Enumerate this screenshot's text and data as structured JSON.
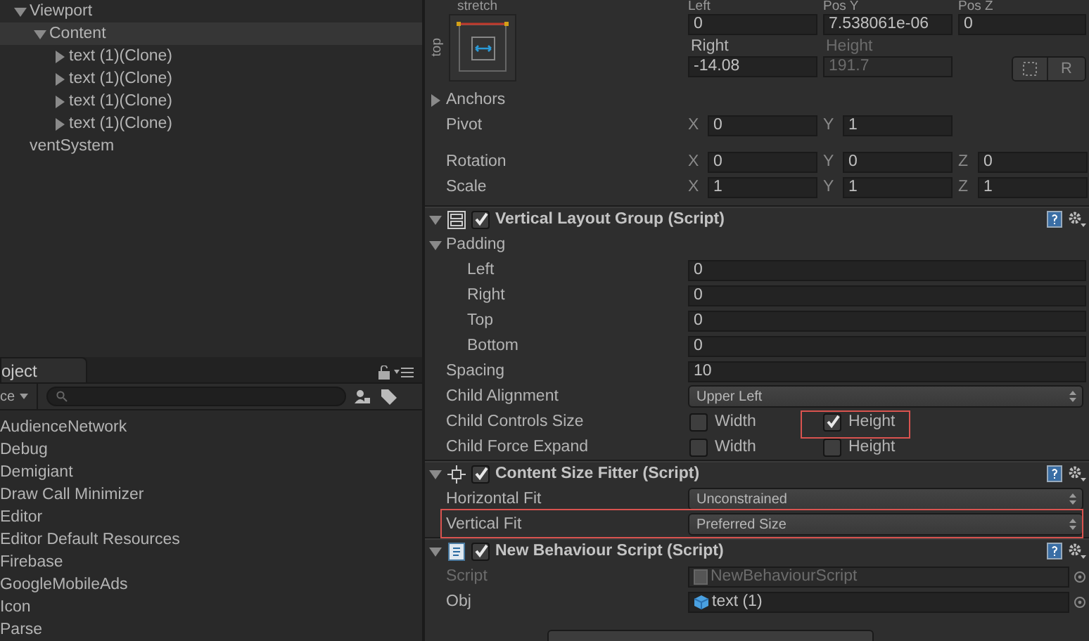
{
  "hierarchy": {
    "items": [
      {
        "label": "Viewport",
        "expanded": true,
        "selected": false,
        "children": [
          {
            "label": "Content",
            "expanded": true,
            "selected": true,
            "children": [
              {
                "label": "text (1)(Clone)",
                "expanded": false,
                "selected": false
              },
              {
                "label": "text (1)(Clone)",
                "expanded": false,
                "selected": false
              },
              {
                "label": "text (1)(Clone)",
                "expanded": false,
                "selected": false
              },
              {
                "label": "text (1)(Clone)",
                "expanded": false,
                "selected": false
              }
            ]
          }
        ]
      },
      {
        "label": "ventSystem",
        "selected": false
      }
    ]
  },
  "project": {
    "tab": "oject",
    "filter": "ce",
    "items": [
      "AudienceNetwork",
      "Debug",
      "Demigiant",
      "Draw Call Minimizer",
      "Editor",
      "Editor Default Resources",
      "Firebase",
      "GoogleMobileAds",
      "Icon",
      "Parse"
    ]
  },
  "inspector": {
    "rect_transform": {
      "preset_label": "stretch",
      "side_label": "top",
      "labels_row1": [
        "Left",
        "Pos Y",
        "Pos Z"
      ],
      "values_row1": [
        {
          "value": "0",
          "disabled": false
        },
        {
          "value": "7.538061e-06",
          "disabled": false
        },
        {
          "value": "0",
          "disabled": false
        }
      ],
      "labels_row2": [
        {
          "label": "Right",
          "disabled": false
        },
        {
          "label": "Height",
          "disabled": true
        }
      ],
      "values_row2": [
        {
          "value": "-14.08",
          "disabled": false
        },
        {
          "value": "191.7",
          "disabled": true
        }
      ],
      "raw_button": "R",
      "anchors": {
        "label": "Anchors",
        "expanded": false
      },
      "pivot": {
        "label": "Pivot",
        "fields": [
          {
            "axis": "X",
            "value": "0"
          },
          {
            "axis": "Y",
            "value": "1"
          }
        ]
      },
      "transform_rows": [
        {
          "label": "Rotation",
          "fields": [
            {
              "axis": "X",
              "value": "0"
            },
            {
              "axis": "Y",
              "value": "0"
            },
            {
              "axis": "Z",
              "value": "0"
            }
          ]
        },
        {
          "label": "Scale",
          "fields": [
            {
              "axis": "X",
              "value": "1"
            },
            {
              "axis": "Y",
              "value": "1"
            },
            {
              "axis": "Z",
              "value": "1"
            }
          ]
        }
      ]
    },
    "components": [
      {
        "kind": "layout",
        "title": "Vertical Layout Group (Script)",
        "enabled": true,
        "rows": [
          {
            "kind": "foldout",
            "label": "Padding",
            "expanded": true,
            "children": [
              {
                "kind": "number",
                "label": "Left",
                "value": "0"
              },
              {
                "kind": "number",
                "label": "Right",
                "value": "0"
              },
              {
                "kind": "number",
                "label": "Top",
                "value": "0"
              },
              {
                "kind": "number",
                "label": "Bottom",
                "value": "0"
              }
            ]
          },
          {
            "kind": "number",
            "label": "Spacing",
            "value": "10"
          },
          {
            "kind": "dropdown",
            "label": "Child Alignment",
            "value": "Upper Left",
            "highlighted": false
          },
          {
            "kind": "toggles",
            "label": "Child Controls Size",
            "toggles": [
              {
                "label": "Width",
                "checked": false,
                "highlighted": false
              },
              {
                "label": "Height",
                "checked": true,
                "highlighted": true
              }
            ]
          },
          {
            "kind": "toggles",
            "label": "Child Force Expand",
            "toggles": [
              {
                "label": "Width",
                "checked": false,
                "highlighted": false
              },
              {
                "label": "Height",
                "checked": false,
                "highlighted": false
              }
            ]
          }
        ]
      },
      {
        "kind": "fitter",
        "title": "Content Size Fitter (Script)",
        "enabled": true,
        "rows": [
          {
            "kind": "dropdown",
            "label": "Horizontal Fit",
            "value": "Unconstrained",
            "highlighted": false
          },
          {
            "kind": "dropdown",
            "label": "Vertical Fit",
            "value": "Preferred Size",
            "highlighted": true
          }
        ]
      },
      {
        "kind": "script",
        "title": "New Behaviour Script (Script)",
        "enabled": true,
        "rows": [
          {
            "kind": "script",
            "label": "Script",
            "value": "NewBehaviourScript",
            "disabled": true
          },
          {
            "kind": "object",
            "label": "Obj",
            "value": "text (1)",
            "disabled": false
          }
        ]
      }
    ]
  }
}
